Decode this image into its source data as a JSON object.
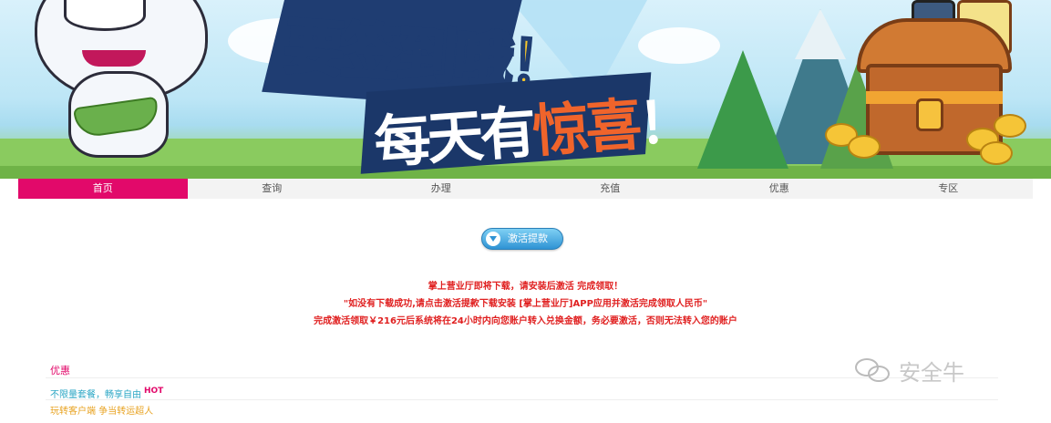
{
  "banner": {
    "slogan_line1": "要签到哦！",
    "slogan_line2_prefix": "每天有",
    "slogan_line2_highlight": "惊喜",
    "slogan_line2_suffix": "！"
  },
  "nav": {
    "items": [
      {
        "label": "首页",
        "active": true
      },
      {
        "label": "查询",
        "active": false
      },
      {
        "label": "办理",
        "active": false
      },
      {
        "label": "充值",
        "active": false
      },
      {
        "label": "优惠",
        "active": false
      },
      {
        "label": "专区",
        "active": false
      }
    ]
  },
  "action": {
    "activate_label": "激活提款"
  },
  "notices": {
    "line1": "掌上营业厅即将下载，请安装后激活 完成领取！",
    "line2": "\"如没有下载成功,请点击激活提款下载安装 [掌上营业厅]APP应用并激活完成领取人民币\"",
    "line3": "完成激活领取￥216元后系统将在24小时内向您账户转入兑换金额，务必要激活，否则无法转入您的账户"
  },
  "promo": {
    "section_title": "优惠",
    "item1": "不限量套餐，畅享自由",
    "item1_badge": "HOT",
    "item2": "玩转客户端 争当转运超人"
  },
  "watermark": {
    "text": "安全牛"
  },
  "colors": {
    "accent": "#e2096a",
    "notice_red": "#e02020",
    "nav_bg": "#f3f3f3",
    "link_blue": "#2aa6c4",
    "link_orange": "#e8a322"
  }
}
